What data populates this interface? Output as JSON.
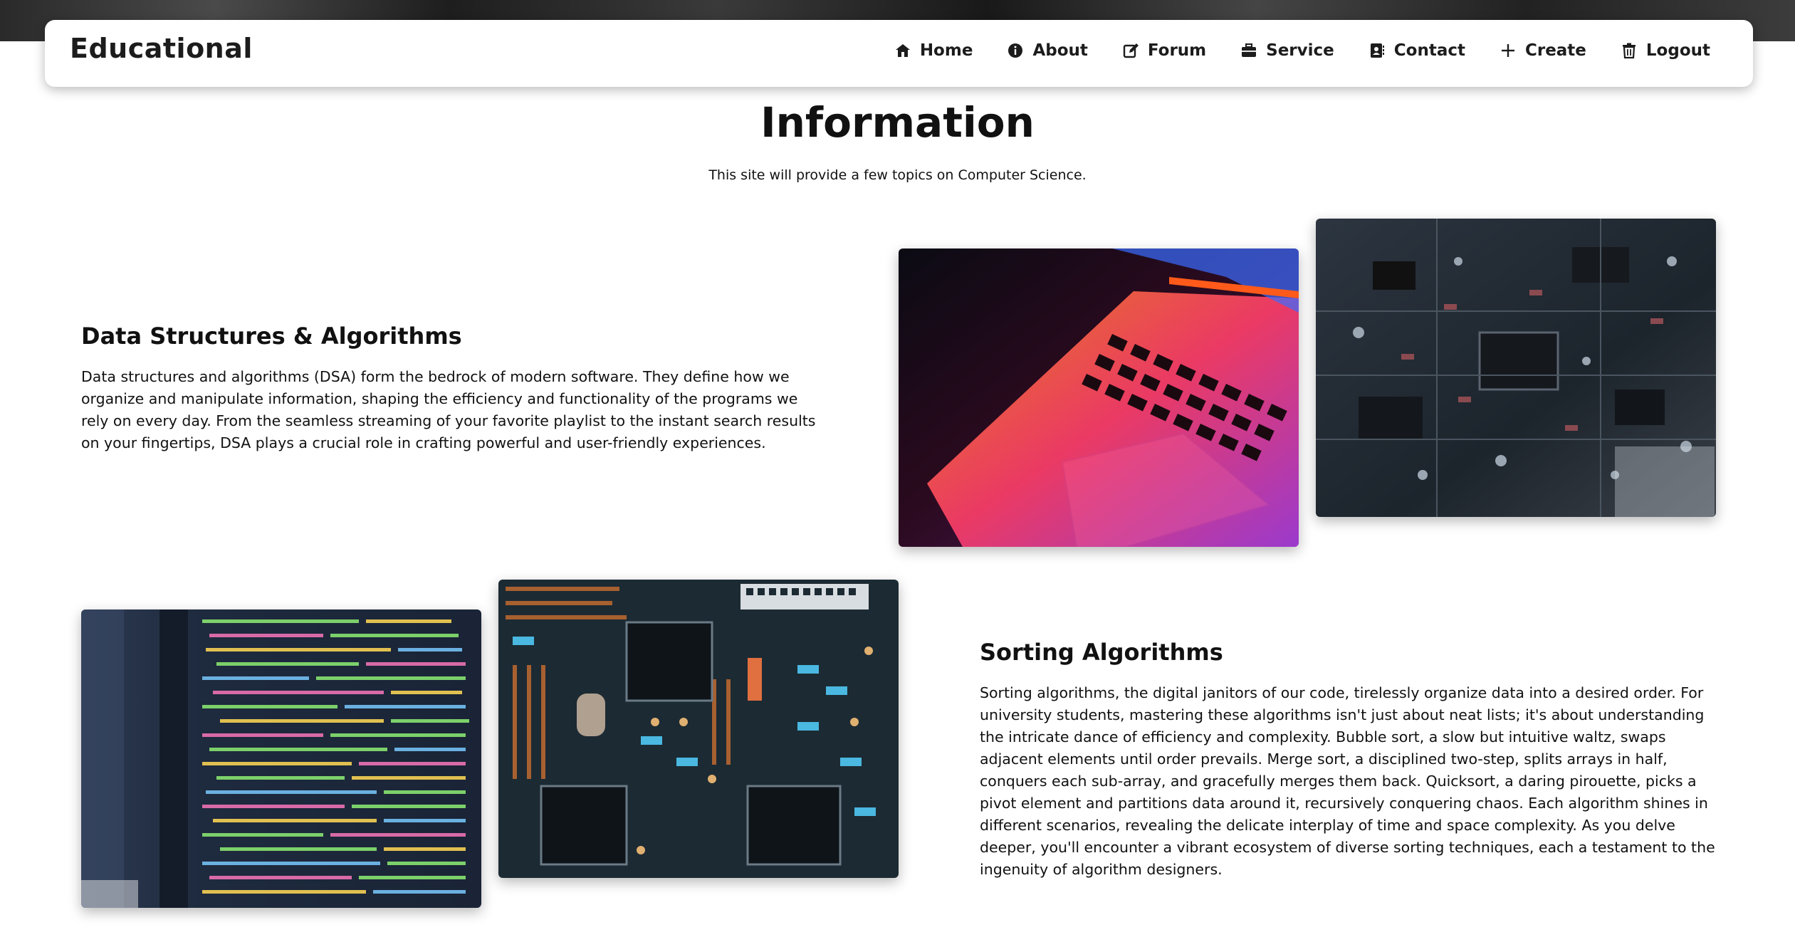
{
  "brand": "Educational",
  "nav": {
    "items": [
      {
        "label": "Home",
        "icon": "home-icon"
      },
      {
        "label": "About",
        "icon": "info-icon"
      },
      {
        "label": "Forum",
        "icon": "edit-icon"
      },
      {
        "label": "Service",
        "icon": "briefcase-icon"
      },
      {
        "label": "Contact",
        "icon": "contact-book-icon"
      },
      {
        "label": "Create",
        "icon": "plus-icon"
      },
      {
        "label": "Logout",
        "icon": "trash-icon"
      }
    ]
  },
  "page": {
    "title": "Information",
    "subtitle": "This site will provide a few topics on Computer Science."
  },
  "sections": [
    {
      "heading": "Data Structures & Algorithms",
      "text": "Data structures and algorithms (DSA) form the bedrock of modern software. They define how we organize and manipulate information, shaping the efficiency and functionality of the programs we rely on every day. From the seamless streaming of your favorite playlist to the instant search results on your fingertips, DSA plays a crucial role in crafting powerful and user-friendly experiences.",
      "images": [
        "laptop-keyboard-photo",
        "circuit-board-photo"
      ]
    },
    {
      "heading": "Sorting Algorithms",
      "text": "Sorting algorithms, the digital janitors of our code, tirelessly organize data into a desired order. For university students, mastering these algorithms isn't just about neat lists; it's about understanding the intricate dance of efficiency and complexity. Bubble sort, a slow but intuitive waltz, swaps adjacent elements until order prevails. Merge sort, a disciplined two-step, splits arrays in half, conquers each sub-array, and gracefully merges them back. Quicksort, a daring pirouette, picks a pivot element and partitions data around it, recursively conquering chaos. Each algorithm shines in different scenarios, revealing the delicate interplay of time and space complexity. As you delve deeper, you'll encounter a vibrant ecosystem of diverse sorting techniques, each a testament to the ingenuity of algorithm designers.",
      "images": [
        "code-screen-photo",
        "pcb-chips-photo"
      ]
    }
  ]
}
